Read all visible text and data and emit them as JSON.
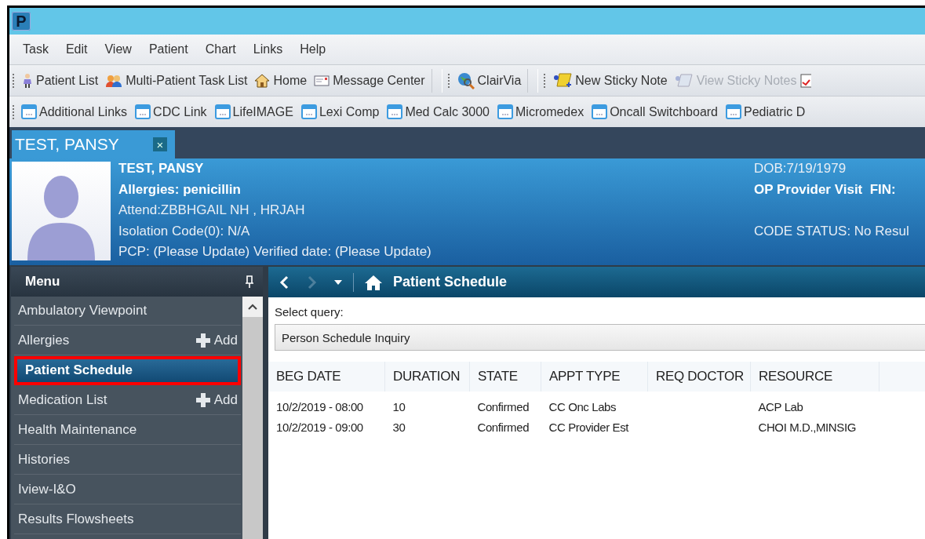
{
  "window": {
    "app_letter": "P"
  },
  "menu_bar": [
    "Task",
    "Edit",
    "View",
    "Patient",
    "Chart",
    "Links",
    "Help"
  ],
  "toolbar": [
    {
      "label": "Patient List",
      "kind": "person",
      "disabled": false
    },
    {
      "label": "Multi-Patient Task List",
      "kind": "group",
      "disabled": false
    },
    {
      "label": "Home",
      "kind": "home",
      "disabled": false
    },
    {
      "label": "Message Center",
      "kind": "mail",
      "disabled": false
    },
    {
      "label": "ClairVia",
      "kind": "globe",
      "disabled": false
    },
    {
      "label": "New Sticky Note",
      "kind": "note",
      "disabled": false
    },
    {
      "label": "View Sticky Notes",
      "kind": "notes",
      "disabled": true
    }
  ],
  "links_bar": [
    "Additional Links",
    "CDC Link",
    "LifeIMAGE",
    "Lexi Comp",
    "Med Calc 3000",
    "Micromedex",
    "Oncall Switchboard",
    "Pediatric D"
  ],
  "patient_tab": {
    "label": "TEST, PANSY",
    "close": "×"
  },
  "banner": {
    "name": "TEST, PANSY",
    "allergies": "Allergies: penicillin",
    "attend": "Attend:ZBBHGAIL NH , HRJAH",
    "isolation": "Isolation Code(0): N/A",
    "pcp": "PCP: (Please Update) Verified date: (Please Update)",
    "dob": "DOB:7/19/1979",
    "visit": "OP Provider Visit  FIN:",
    "code_status": "CODE STATUS: No Resul"
  },
  "sidebar": {
    "title": "Menu",
    "items": [
      {
        "label": "Ambulatory Viewpoint",
        "selected": false
      },
      {
        "label": "Allergies",
        "selected": false,
        "add": "Add"
      },
      {
        "label": "Patient Schedule",
        "selected": true
      },
      {
        "label": "Medication List",
        "selected": false,
        "add": "Add"
      },
      {
        "label": "Health Maintenance",
        "selected": false
      },
      {
        "label": "Histories",
        "selected": false
      },
      {
        "label": "Iview-I&O",
        "selected": false
      },
      {
        "label": "Results Flowsheets",
        "selected": false
      }
    ]
  },
  "content": {
    "title": "Patient Schedule",
    "query_label": "Select query:",
    "query_value": "Person Schedule Inquiry",
    "table": {
      "columns": [
        "BEG DATE",
        "DURATION",
        "STATE",
        "APPT TYPE",
        "REQ DOCTOR",
        "RESOURCE"
      ],
      "rows": [
        [
          "10/2/2019 - 08:00",
          "10",
          "Confirmed",
          "CC Onc Labs",
          null,
          "ACP Lab"
        ],
        [
          "10/2/2019 - 09:00",
          "30",
          "Confirmed",
          "CC Provider Est",
          null,
          "CHOI M.D.,MINSIG"
        ]
      ]
    }
  }
}
